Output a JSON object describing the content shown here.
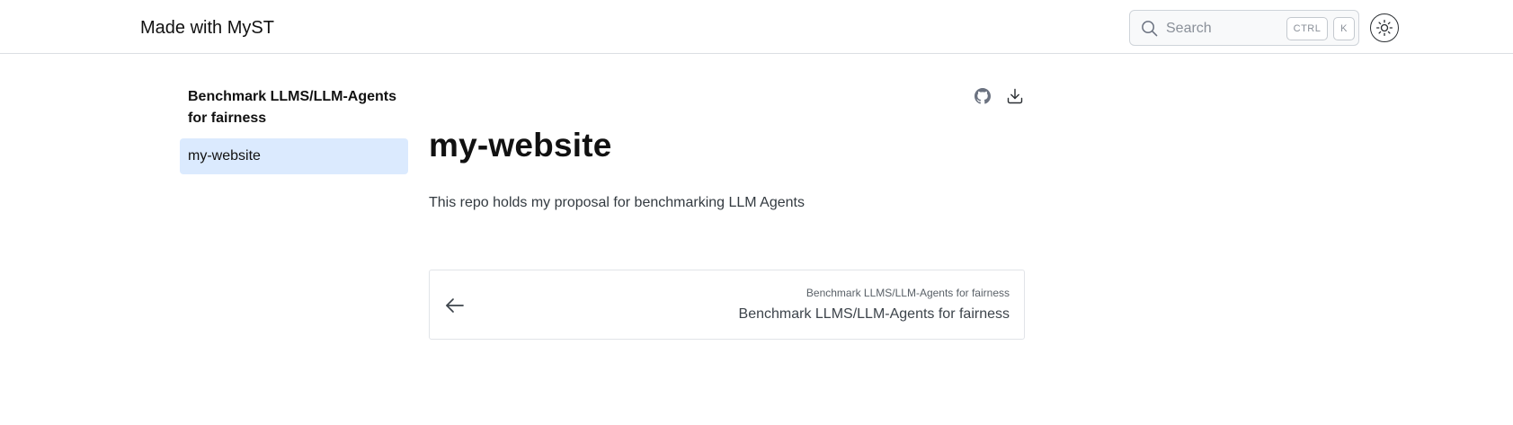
{
  "header": {
    "brand": "Made with MyST",
    "search": {
      "placeholder": "Search",
      "shortcut_keys": [
        "CTRL",
        "K"
      ]
    },
    "theme_toggle_icon": "sun-icon"
  },
  "sidebar": {
    "title": "Benchmark LLMS/LLM-Agents for fairness",
    "items": [
      {
        "label": "my-website",
        "active": true
      }
    ]
  },
  "main": {
    "actions": [
      {
        "icon": "github-icon"
      },
      {
        "icon": "download-icon"
      }
    ],
    "title": "my-website",
    "description": "This repo holds my proposal for benchmarking LLM Agents"
  },
  "prev_link": {
    "icon": "arrow-left-icon",
    "small_label": "Benchmark LLMS/LLM-Agents for fairness",
    "label": "Benchmark LLMS/LLM-Agents for fairness"
  },
  "colors": {
    "active_item_bg": "#dbeafe",
    "border": "#dcdfe3"
  }
}
